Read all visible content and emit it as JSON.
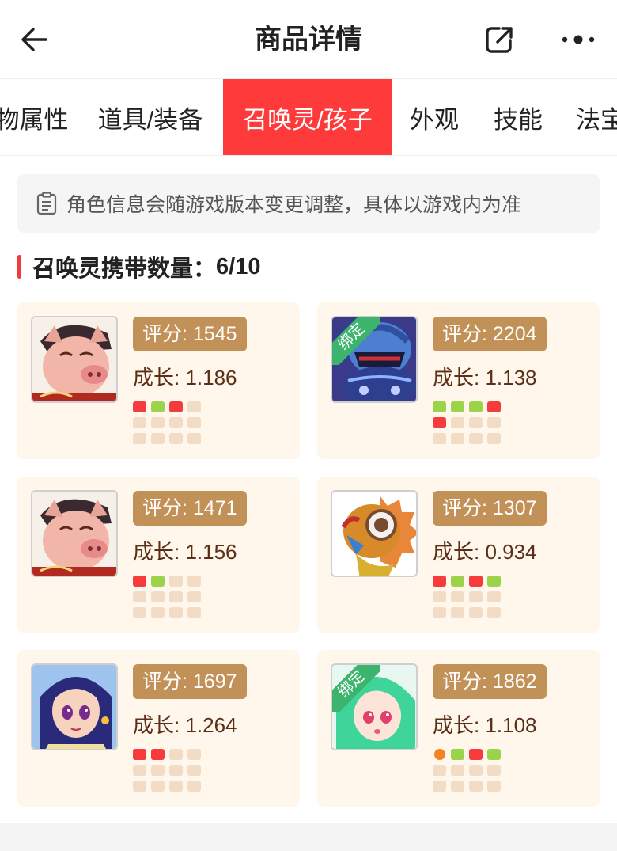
{
  "header": {
    "title": "商品详情",
    "back_icon": "arrow-left-icon",
    "share_icon": "share-icon",
    "more_icon": "more-dots-icon"
  },
  "tabs": [
    {
      "label": "物属性",
      "active": false
    },
    {
      "label": "道具/装备",
      "active": false
    },
    {
      "label": "召唤灵/孩子",
      "active": true
    },
    {
      "label": "外观",
      "active": false
    },
    {
      "label": "技能",
      "active": false
    },
    {
      "label": "法宝",
      "active": false
    }
  ],
  "notice": {
    "icon": "clipboard-icon",
    "text": "角色信息会随游戏版本变更调整，具体以游戏内为准"
  },
  "section": {
    "label": "召唤灵携带数量：",
    "count": "6/10"
  },
  "colors": {
    "accent": "#ff3a3a",
    "score_badge": "#c19157",
    "card_bg": "#fff6ec",
    "bound_tag": "#3cb46e",
    "dot_red": "#f53b3b",
    "dot_green": "#9bd44b",
    "dot_orange": "#f5821f",
    "dot_empty": "#f3dcc6"
  },
  "bound_label": "绑定",
  "cards": [
    {
      "score": "评分: 1545",
      "growth": "成长: 1.186",
      "bound": false,
      "avatar": "pig-warrior-avatar",
      "dots": [
        "red",
        "green",
        "red",
        "empty",
        "empty",
        "empty",
        "empty",
        "empty",
        "empty",
        "empty",
        "empty",
        "empty"
      ]
    },
    {
      "score": "评分: 2204",
      "growth": "成长: 1.138",
      "bound": true,
      "avatar": "armored-knight-avatar",
      "dots": [
        "green",
        "green",
        "green",
        "red",
        "red",
        "empty",
        "empty",
        "empty",
        "empty",
        "empty",
        "empty",
        "empty"
      ]
    },
    {
      "score": "评分: 1471",
      "growth": "成长: 1.156",
      "bound": false,
      "avatar": "pig-warrior-avatar",
      "dots": [
        "red",
        "green",
        "empty",
        "empty",
        "empty",
        "empty",
        "empty",
        "empty",
        "empty",
        "empty",
        "empty",
        "empty"
      ]
    },
    {
      "score": "评分: 1307",
      "growth": "成长: 0.934",
      "bound": false,
      "avatar": "spiky-robot-avatar",
      "dots": [
        "red",
        "green",
        "red",
        "green",
        "empty",
        "empty",
        "empty",
        "empty",
        "empty",
        "empty",
        "empty",
        "empty"
      ]
    },
    {
      "score": "评分: 1697",
      "growth": "成长: 1.264",
      "bound": false,
      "avatar": "blue-hair-girl-avatar",
      "dots": [
        "red",
        "red",
        "empty",
        "empty",
        "empty",
        "empty",
        "empty",
        "empty",
        "empty",
        "empty",
        "empty",
        "empty"
      ]
    },
    {
      "score": "评分: 1862",
      "growth": "成长: 1.108",
      "bound": true,
      "avatar": "green-hair-girl-avatar",
      "dots": [
        "orange",
        "green",
        "red",
        "green",
        "empty",
        "empty",
        "empty",
        "empty",
        "empty",
        "empty",
        "empty",
        "empty"
      ]
    }
  ]
}
